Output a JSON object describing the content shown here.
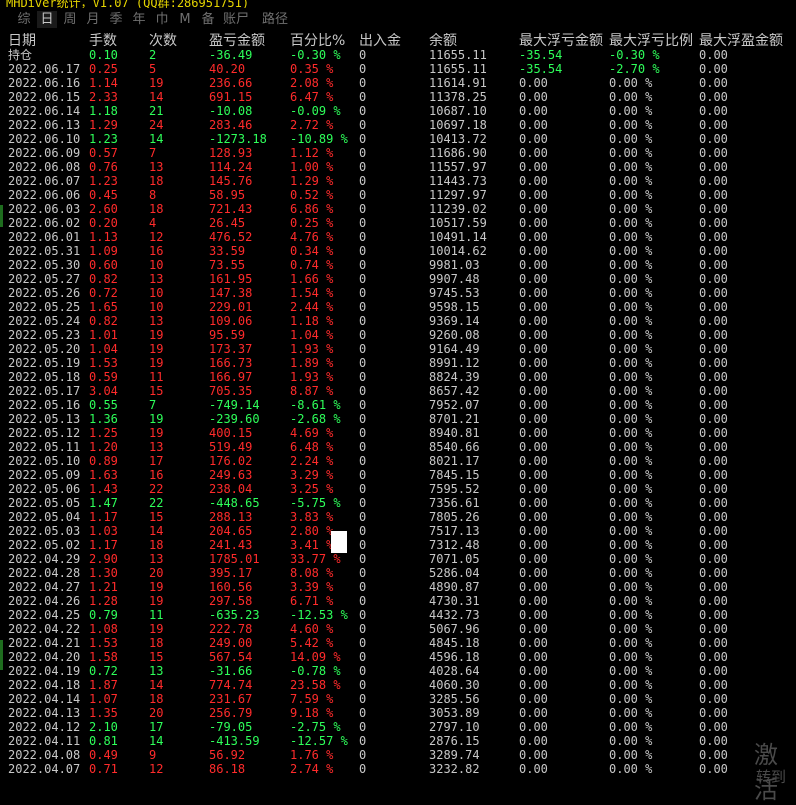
{
  "app": {
    "title": "MHDiver统计，V1.07 (QQ群:286951751)"
  },
  "tabs": [
    "综",
    "日",
    "周",
    "月",
    "季",
    "年",
    "巾",
    "M",
    "备",
    "账尸",
    "路径"
  ],
  "active_tab": 1,
  "headers": [
    "日期",
    "手数",
    "次数",
    "盈亏金额",
    "百分比%",
    "出入金",
    "余额",
    "最大浮亏金额",
    "最大浮亏比例",
    "最大浮盈金额"
  ],
  "rows": [
    [
      "持仓",
      "0.10",
      "2",
      "-36.49",
      "-0.30 %",
      "0",
      "11655.11",
      "-35.54",
      "-0.30 %",
      "0.00"
    ],
    [
      "2022.06.17",
      "0.25",
      "5",
      "40.20",
      "0.35 %",
      "0",
      "11655.11",
      "-35.54",
      "-2.70 %",
      "0.00"
    ],
    [
      "2022.06.16",
      "1.14",
      "19",
      "236.66",
      "2.08 %",
      "0",
      "11614.91",
      "0.00",
      "0.00 %",
      "0.00"
    ],
    [
      "2022.06.15",
      "2.33",
      "14",
      "691.15",
      "6.47 %",
      "0",
      "11378.25",
      "0.00",
      "0.00 %",
      "0.00"
    ],
    [
      "2022.06.14",
      "1.18",
      "21",
      "-10.08",
      "-0.09 %",
      "0",
      "10687.10",
      "0.00",
      "0.00 %",
      "0.00"
    ],
    [
      "2022.06.13",
      "1.29",
      "24",
      "283.46",
      "2.72 %",
      "0",
      "10697.18",
      "0.00",
      "0.00 %",
      "0.00"
    ],
    [
      "2022.06.10",
      "1.23",
      "14",
      "-1273.18",
      "-10.89 %",
      "0",
      "10413.72",
      "0.00",
      "0.00 %",
      "0.00"
    ],
    [
      "2022.06.09",
      "0.57",
      "7",
      "128.93",
      "1.12 %",
      "0",
      "11686.90",
      "0.00",
      "0.00 %",
      "0.00"
    ],
    [
      "2022.06.08",
      "0.76",
      "13",
      "114.24",
      "1.00 %",
      "0",
      "11557.97",
      "0.00",
      "0.00 %",
      "0.00"
    ],
    [
      "2022.06.07",
      "1.23",
      "18",
      "145.76",
      "1.29 %",
      "0",
      "11443.73",
      "0.00",
      "0.00 %",
      "0.00"
    ],
    [
      "2022.06.06",
      "0.45",
      "8",
      "58.95",
      "0.52 %",
      "0",
      "11297.97",
      "0.00",
      "0.00 %",
      "0.00"
    ],
    [
      "2022.06.03",
      "2.60",
      "18",
      "721.43",
      "6.86 %",
      "0",
      "11239.02",
      "0.00",
      "0.00 %",
      "0.00"
    ],
    [
      "2022.06.02",
      "0.20",
      "4",
      "26.45",
      "0.25 %",
      "0",
      "10517.59",
      "0.00",
      "0.00 %",
      "0.00"
    ],
    [
      "2022.06.01",
      "1.13",
      "12",
      "476.52",
      "4.76 %",
      "0",
      "10491.14",
      "0.00",
      "0.00 %",
      "0.00"
    ],
    [
      "2022.05.31",
      "1.09",
      "16",
      "33.59",
      "0.34 %",
      "0",
      "10014.62",
      "0.00",
      "0.00 %",
      "0.00"
    ],
    [
      "2022.05.30",
      "0.60",
      "10",
      "73.55",
      "0.74 %",
      "0",
      "9981.03",
      "0.00",
      "0.00 %",
      "0.00"
    ],
    [
      "2022.05.27",
      "0.82",
      "13",
      "161.95",
      "1.66 %",
      "0",
      "9907.48",
      "0.00",
      "0.00 %",
      "0.00"
    ],
    [
      "2022.05.26",
      "0.72",
      "10",
      "147.38",
      "1.54 %",
      "0",
      "9745.53",
      "0.00",
      "0.00 %",
      "0.00"
    ],
    [
      "2022.05.25",
      "1.65",
      "10",
      "229.01",
      "2.44 %",
      "0",
      "9598.15",
      "0.00",
      "0.00 %",
      "0.00"
    ],
    [
      "2022.05.24",
      "0.82",
      "13",
      "109.06",
      "1.18 %",
      "0",
      "9369.14",
      "0.00",
      "0.00 %",
      "0.00"
    ],
    [
      "2022.05.23",
      "1.01",
      "19",
      "95.59",
      "1.04 %",
      "0",
      "9260.08",
      "0.00",
      "0.00 %",
      "0.00"
    ],
    [
      "2022.05.20",
      "1.04",
      "19",
      "173.37",
      "1.93 %",
      "0",
      "9164.49",
      "0.00",
      "0.00 %",
      "0.00"
    ],
    [
      "2022.05.19",
      "1.53",
      "19",
      "166.73",
      "1.89 %",
      "0",
      "8991.12",
      "0.00",
      "0.00 %",
      "0.00"
    ],
    [
      "2022.05.18",
      "0.59",
      "11",
      "166.97",
      "1.93 %",
      "0",
      "8824.39",
      "0.00",
      "0.00 %",
      "0.00"
    ],
    [
      "2022.05.17",
      "3.04",
      "15",
      "705.35",
      "8.87 %",
      "0",
      "8657.42",
      "0.00",
      "0.00 %",
      "0.00"
    ],
    [
      "2022.05.16",
      "0.55",
      "7",
      "-749.14",
      "-8.61 %",
      "0",
      "7952.07",
      "0.00",
      "0.00 %",
      "0.00"
    ],
    [
      "2022.05.13",
      "1.36",
      "19",
      "-239.60",
      "-2.68 %",
      "0",
      "8701.21",
      "0.00",
      "0.00 %",
      "0.00"
    ],
    [
      "2022.05.12",
      "1.25",
      "19",
      "400.15",
      "4.69 %",
      "0",
      "8940.81",
      "0.00",
      "0.00 %",
      "0.00"
    ],
    [
      "2022.05.11",
      "1.20",
      "13",
      "519.49",
      "6.48 %",
      "0",
      "8540.66",
      "0.00",
      "0.00 %",
      "0.00"
    ],
    [
      "2022.05.10",
      "0.89",
      "17",
      "176.02",
      "2.24 %",
      "0",
      "8021.17",
      "0.00",
      "0.00 %",
      "0.00"
    ],
    [
      "2022.05.09",
      "1.63",
      "16",
      "249.63",
      "3.29 %",
      "0",
      "7845.15",
      "0.00",
      "0.00 %",
      "0.00"
    ],
    [
      "2022.05.06",
      "1.43",
      "22",
      "238.04",
      "3.25 %",
      "0",
      "7595.52",
      "0.00",
      "0.00 %",
      "0.00"
    ],
    [
      "2022.05.05",
      "1.47",
      "22",
      "-448.65",
      "-5.75 %",
      "0",
      "7356.61",
      "0.00",
      "0.00 %",
      "0.00"
    ],
    [
      "2022.05.04",
      "1.17",
      "15",
      "288.13",
      "3.83 %",
      "0",
      "7805.26",
      "0.00",
      "0.00 %",
      "0.00"
    ],
    [
      "2022.05.03",
      "1.03",
      "14",
      "204.65",
      "2.80 %",
      "0",
      "7517.13",
      "0.00",
      "0.00 %",
      "0.00"
    ],
    [
      "2022.05.02",
      "1.17",
      "18",
      "241.43",
      "3.41 %",
      "0",
      "7312.48",
      "0.00",
      "0.00 %",
      "0.00"
    ],
    [
      "2022.04.29",
      "2.90",
      "13",
      "1785.01",
      "33.77 %",
      "0",
      "7071.05",
      "0.00",
      "0.00 %",
      "0.00"
    ],
    [
      "2022.04.28",
      "1.30",
      "20",
      "395.17",
      "8.08 %",
      "0",
      "5286.04",
      "0.00",
      "0.00 %",
      "0.00"
    ],
    [
      "2022.04.27",
      "1.21",
      "19",
      "160.56",
      "3.39 %",
      "0",
      "4890.87",
      "0.00",
      "0.00 %",
      "0.00"
    ],
    [
      "2022.04.26",
      "1.28",
      "19",
      "297.58",
      "6.71 %",
      "0",
      "4730.31",
      "0.00",
      "0.00 %",
      "0.00"
    ],
    [
      "2022.04.25",
      "0.79",
      "11",
      "-635.23",
      "-12.53 %",
      "0",
      "4432.73",
      "0.00",
      "0.00 %",
      "0.00"
    ],
    [
      "2022.04.22",
      "1.08",
      "19",
      "222.78",
      "4.60 %",
      "0",
      "5067.96",
      "0.00",
      "0.00 %",
      "0.00"
    ],
    [
      "2022.04.21",
      "1.53",
      "18",
      "249.00",
      "5.42 %",
      "0",
      "4845.18",
      "0.00",
      "0.00 %",
      "0.00"
    ],
    [
      "2022.04.20",
      "1.58",
      "15",
      "567.54",
      "14.09 %",
      "0",
      "4596.18",
      "0.00",
      "0.00 %",
      "0.00"
    ],
    [
      "2022.04.19",
      "0.72",
      "13",
      "-31.66",
      "-0.78 %",
      "0",
      "4028.64",
      "0.00",
      "0.00 %",
      "0.00"
    ],
    [
      "2022.04.18",
      "1.87",
      "14",
      "774.74",
      "23.58 %",
      "0",
      "4060.30",
      "0.00",
      "0.00 %",
      "0.00"
    ],
    [
      "2022.04.14",
      "1.07",
      "18",
      "231.67",
      "7.59 %",
      "0",
      "3285.56",
      "0.00",
      "0.00 %",
      "0.00"
    ],
    [
      "2022.04.13",
      "1.35",
      "20",
      "256.79",
      "9.18 %",
      "0",
      "3053.89",
      "0.00",
      "0.00 %",
      "0.00"
    ],
    [
      "2022.04.12",
      "2.10",
      "17",
      "-79.05",
      "-2.75 %",
      "0",
      "2797.10",
      "0.00",
      "0.00 %",
      "0.00"
    ],
    [
      "2022.04.11",
      "0.81",
      "14",
      "-413.59",
      "-12.57 %",
      "0",
      "2876.15",
      "0.00",
      "0.00 %",
      "0.00"
    ],
    [
      "2022.04.08",
      "0.49",
      "9",
      "56.92",
      "1.76 %",
      "0",
      "3289.74",
      "0.00",
      "0.00 %",
      "0.00"
    ],
    [
      "2022.04.07",
      "0.71",
      "12",
      "86.18",
      "2.74 %",
      "0",
      "3232.82",
      "0.00",
      "0.00 %",
      "0.00"
    ]
  ],
  "watermark": {
    "line1": "激活",
    "line2": "转到"
  },
  "colors": {
    "positive": "#ff2b2b",
    "negative": "#2eff5a",
    "neutral": "#c8c8c8",
    "title": "#e6d500",
    "background": "#000000"
  }
}
